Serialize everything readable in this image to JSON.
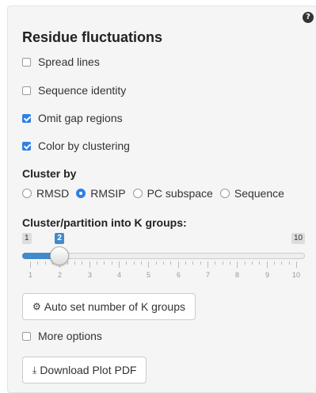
{
  "panel": {
    "title": "Residue fluctuations",
    "help_icon": "question-circle-icon",
    "checkboxes": [
      {
        "label": "Spread lines",
        "checked": false
      },
      {
        "label": "Sequence identity",
        "checked": false
      },
      {
        "label": "Omit gap regions",
        "checked": true
      },
      {
        "label": "Color by clustering",
        "checked": true
      }
    ],
    "cluster_by": {
      "label": "Cluster by",
      "options": [
        {
          "label": "RMSD",
          "selected": false
        },
        {
          "label": "RMSIP",
          "selected": true
        },
        {
          "label": "PC subspace",
          "selected": false
        },
        {
          "label": "Sequence",
          "selected": false
        }
      ]
    },
    "k_groups": {
      "label": "Cluster/partition into K groups:",
      "min": 1,
      "max": 10,
      "value": 2,
      "min_label": "1",
      "max_label": "10",
      "value_label": "2",
      "tick_labels": [
        "1",
        "2",
        "3",
        "4",
        "5",
        "6",
        "7",
        "8",
        "9",
        "10"
      ]
    },
    "auto_button": {
      "label": "Auto set number of K groups",
      "icon": "cogs-icon"
    },
    "more_options": {
      "label": "More options",
      "checked": false
    },
    "download_button": {
      "label": "Download Plot PDF",
      "icon": "download-icon"
    }
  },
  "colors": {
    "accent": "#2f7fe6",
    "slider_fill": "#428bca",
    "panel_bg": "#f5f5f5"
  }
}
